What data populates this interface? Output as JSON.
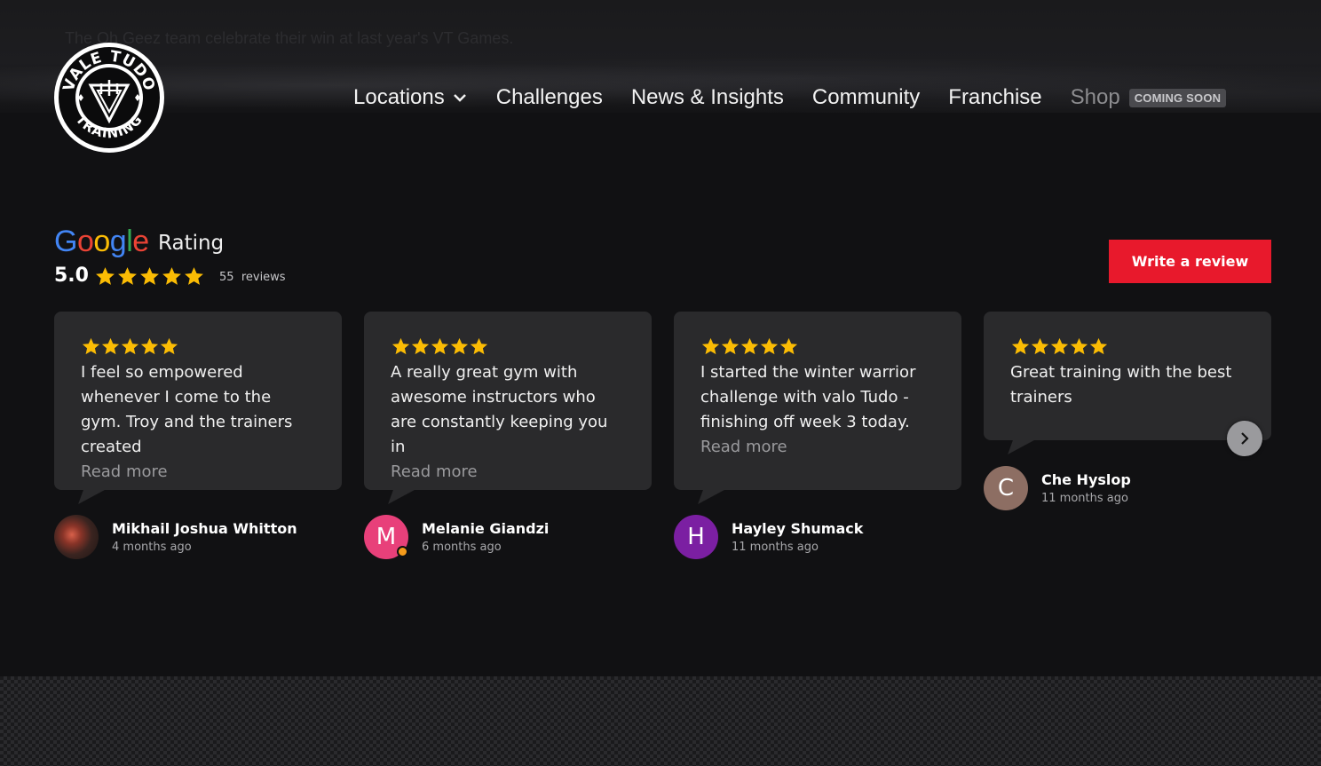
{
  "hero": {
    "caption": "The Oh Geez team celebrate their win at last year's VT Games."
  },
  "logo": {
    "top_text": "VALE TUDO",
    "bottom_text": "TRAINING"
  },
  "nav": {
    "items": [
      {
        "label": "Locations",
        "has_dropdown": true
      },
      {
        "label": "Challenges"
      },
      {
        "label": "News & Insights"
      },
      {
        "label": "Community"
      },
      {
        "label": "Franchise"
      },
      {
        "label": "Shop",
        "badge": "COMING SOON"
      }
    ]
  },
  "rating": {
    "brand": "Google",
    "label": "Rating",
    "score": "5.0",
    "stars": 5,
    "count": "55",
    "count_label": "reviews",
    "write_review": "Write a review"
  },
  "reviews": [
    {
      "stars": 5,
      "text": "I feel so empowered whenever I come to the gym. Troy and the trainers created",
      "read_more": "Read more",
      "author": "Mikhail Joshua Whitton",
      "date": "4 months ago",
      "avatar": "photo"
    },
    {
      "stars": 5,
      "text": "A really great gym with awesome instructors who are constantly keeping you in",
      "read_more": "Read more",
      "author": "Melanie Giandzi",
      "date": "6 months ago",
      "avatar_letter": "M",
      "avatar_color": "#e8407a"
    },
    {
      "stars": 5,
      "text": "I started the winter warrior challenge with valo Tudo - finishing off week 3 today.",
      "read_more": "Read more",
      "author": "Hayley Shumack",
      "date": "11 months ago",
      "avatar_letter": "H",
      "avatar_color": "#7b1fa2"
    },
    {
      "stars": 5,
      "text": "Great training with the best trainers",
      "author": "Che Hyslop",
      "date": "11 months ago",
      "avatar_letter": "C",
      "avatar_color": "#8d6e63"
    }
  ],
  "colors": {
    "accent": "#e8192c",
    "star": "#fbbc04",
    "card": "#2a2a2c",
    "background": "#111113"
  }
}
